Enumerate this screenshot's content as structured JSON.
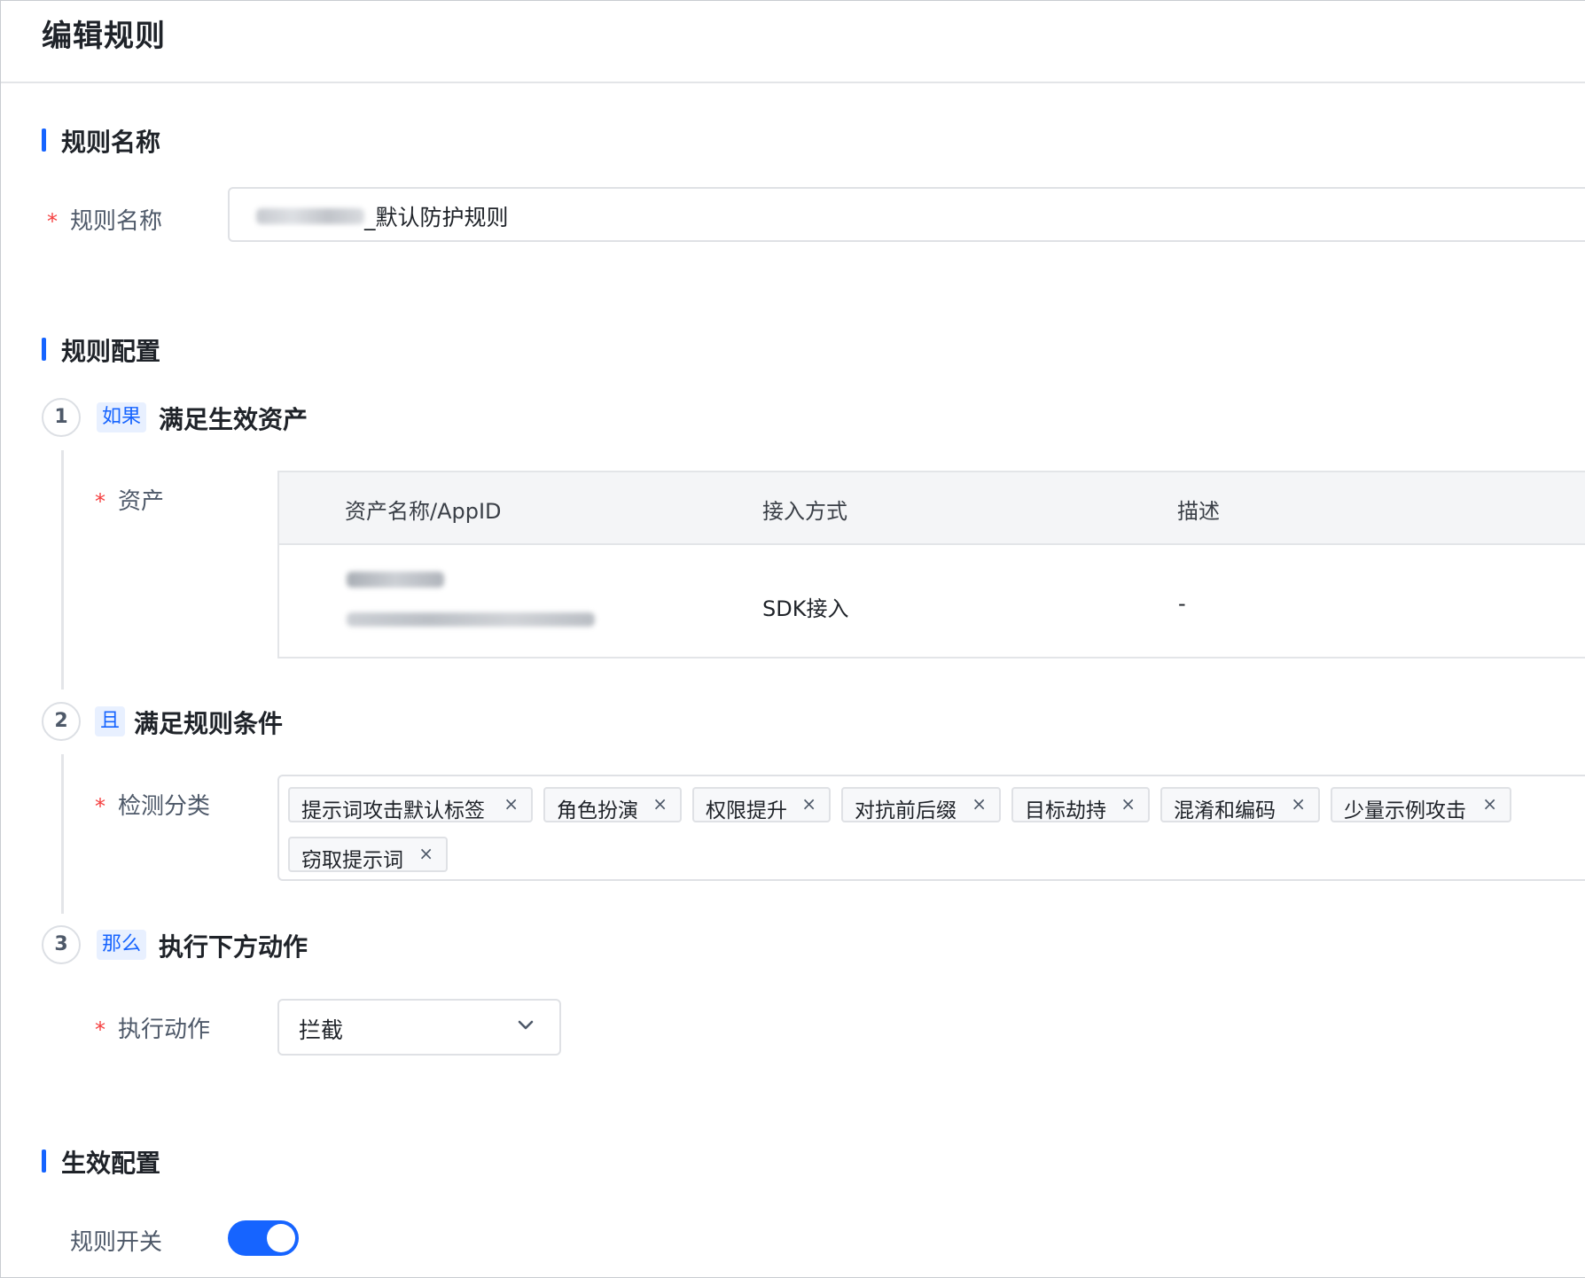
{
  "page": {
    "title": "编辑规则"
  },
  "section_name": {
    "title": "规则名称",
    "field_label": "规则名称",
    "field_value": "_默认防护规则"
  },
  "section_config": {
    "title": "规则配置",
    "steps": [
      {
        "num": "1",
        "tag": "如果",
        "title": "满足生效资产"
      },
      {
        "num": "2",
        "tag": "且",
        "title": "满足规则条件"
      },
      {
        "num": "3",
        "tag": "那么",
        "title": "执行下方动作"
      }
    ],
    "asset": {
      "label": "资产",
      "columns": [
        "资产名称/AppID",
        "接入方式",
        "描述"
      ],
      "row": {
        "access": "SDK接入",
        "desc": "-"
      }
    },
    "detection": {
      "label": "检测分类",
      "tags": [
        "提示词攻击默认标签",
        "角色扮演",
        "权限提升",
        "对抗前后缀",
        "目标劫持",
        "混淆和编码",
        "少量示例攻击",
        "窃取提示词"
      ]
    },
    "action": {
      "label": "执行动作",
      "value": "拦截"
    }
  },
  "section_effect": {
    "title": "生效配置",
    "switch_label": "规则开关",
    "switch_on": true,
    "accent": "#1664ff"
  },
  "icons": {
    "tag_close": "×",
    "required_mark": "*"
  }
}
